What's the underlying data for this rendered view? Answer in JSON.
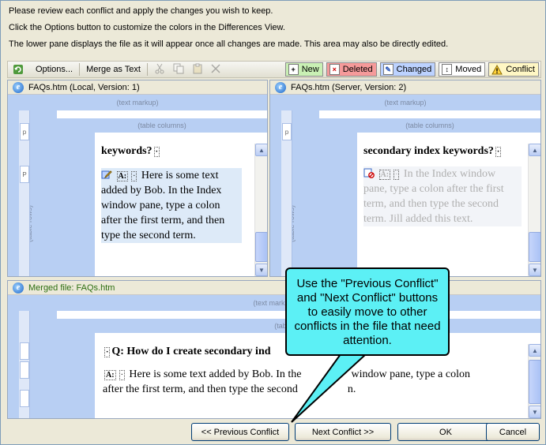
{
  "instructions": [
    "Please review each conflict and apply the changes you wish to keep.",
    "Click the Options button to customize the colors in the Differences View.",
    "The lower pane displays the file as it will appear once all changes are made. This area may also be directly edited."
  ],
  "toolbar": {
    "options_label": "Options...",
    "merge_label": "Merge as Text"
  },
  "legend": {
    "new": "New",
    "deleted": "Deleted",
    "changed": "Changed",
    "moved": "Moved",
    "conflict": "Conflict"
  },
  "colors": {
    "new": "#c9f0b4",
    "deleted": "#f59a9a",
    "changed": "#bcd2ff",
    "moved": "#ffffff",
    "conflict": "#fff7c4",
    "callout": "#5cf0f5"
  },
  "local_pane": {
    "title": "FAQs.htm (Local, Version: 1)",
    "markup_label": "(text markup)",
    "columns_label": "(table columns)",
    "rows_label": "(table rows)",
    "p_tick": "p",
    "p_tick2": "P",
    "heading": "keywords?",
    "answer_label": "A:",
    "answer_text": "Here is some text added by Bob. In the Index window pane, type a colon after the first term, and then type the second term."
  },
  "server_pane": {
    "title": "FAQs.htm (Server, Version: 2)",
    "markup_label": "(text markup)",
    "columns_label": "(table columns)",
    "rows_label": "(table rows)",
    "p_tick": "p",
    "heading": "secondary index keywords?",
    "answer_label": "A:",
    "answer_text": "In the Index window pane, type a colon after the first term, and then type the second term. Jill added this text."
  },
  "merged_pane": {
    "title": "Merged file: FAQs.htm",
    "markup_label": "(text markup)",
    "columns_label": "(table columns)",
    "question": "Q: How do I create secondary ind",
    "answer_label": "A:",
    "answer_line1": "Here is some text added by Bob. In the",
    "answer_line1b": "window pane, type a colon",
    "answer_line2": "after the first term, and then type the second",
    "answer_line2b": "n."
  },
  "callout": {
    "text": "Use the \"Previous Conflict\" and \"Next Conflict\" buttons to easily move to other conflicts in the file that need attention."
  },
  "buttons": {
    "previous_conflict": "<< Previous Conflict",
    "next_conflict": "Next Conflict >>",
    "ok": "OK",
    "cancel": "Cancel"
  }
}
